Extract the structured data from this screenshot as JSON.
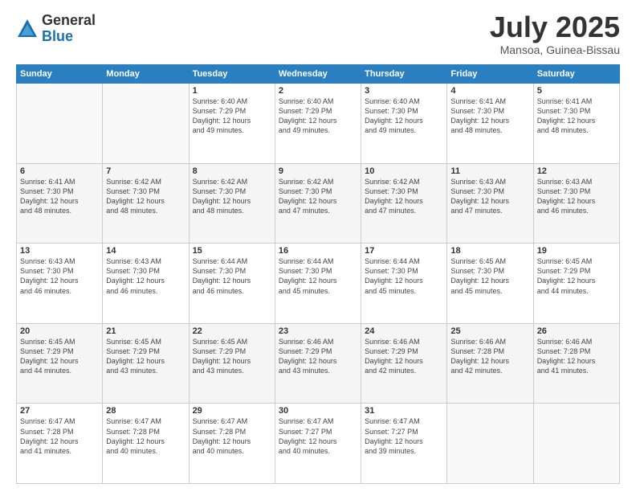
{
  "header": {
    "logo_general": "General",
    "logo_blue": "Blue",
    "month": "July 2025",
    "location": "Mansoa, Guinea-Bissau"
  },
  "days_of_week": [
    "Sunday",
    "Monday",
    "Tuesday",
    "Wednesday",
    "Thursday",
    "Friday",
    "Saturday"
  ],
  "weeks": [
    [
      {
        "day": "",
        "info": ""
      },
      {
        "day": "",
        "info": ""
      },
      {
        "day": "1",
        "info": "Sunrise: 6:40 AM\nSunset: 7:29 PM\nDaylight: 12 hours\nand 49 minutes."
      },
      {
        "day": "2",
        "info": "Sunrise: 6:40 AM\nSunset: 7:29 PM\nDaylight: 12 hours\nand 49 minutes."
      },
      {
        "day": "3",
        "info": "Sunrise: 6:40 AM\nSunset: 7:30 PM\nDaylight: 12 hours\nand 49 minutes."
      },
      {
        "day": "4",
        "info": "Sunrise: 6:41 AM\nSunset: 7:30 PM\nDaylight: 12 hours\nand 48 minutes."
      },
      {
        "day": "5",
        "info": "Sunrise: 6:41 AM\nSunset: 7:30 PM\nDaylight: 12 hours\nand 48 minutes."
      }
    ],
    [
      {
        "day": "6",
        "info": "Sunrise: 6:41 AM\nSunset: 7:30 PM\nDaylight: 12 hours\nand 48 minutes."
      },
      {
        "day": "7",
        "info": "Sunrise: 6:42 AM\nSunset: 7:30 PM\nDaylight: 12 hours\nand 48 minutes."
      },
      {
        "day": "8",
        "info": "Sunrise: 6:42 AM\nSunset: 7:30 PM\nDaylight: 12 hours\nand 48 minutes."
      },
      {
        "day": "9",
        "info": "Sunrise: 6:42 AM\nSunset: 7:30 PM\nDaylight: 12 hours\nand 47 minutes."
      },
      {
        "day": "10",
        "info": "Sunrise: 6:42 AM\nSunset: 7:30 PM\nDaylight: 12 hours\nand 47 minutes."
      },
      {
        "day": "11",
        "info": "Sunrise: 6:43 AM\nSunset: 7:30 PM\nDaylight: 12 hours\nand 47 minutes."
      },
      {
        "day": "12",
        "info": "Sunrise: 6:43 AM\nSunset: 7:30 PM\nDaylight: 12 hours\nand 46 minutes."
      }
    ],
    [
      {
        "day": "13",
        "info": "Sunrise: 6:43 AM\nSunset: 7:30 PM\nDaylight: 12 hours\nand 46 minutes."
      },
      {
        "day": "14",
        "info": "Sunrise: 6:43 AM\nSunset: 7:30 PM\nDaylight: 12 hours\nand 46 minutes."
      },
      {
        "day": "15",
        "info": "Sunrise: 6:44 AM\nSunset: 7:30 PM\nDaylight: 12 hours\nand 46 minutes."
      },
      {
        "day": "16",
        "info": "Sunrise: 6:44 AM\nSunset: 7:30 PM\nDaylight: 12 hours\nand 45 minutes."
      },
      {
        "day": "17",
        "info": "Sunrise: 6:44 AM\nSunset: 7:30 PM\nDaylight: 12 hours\nand 45 minutes."
      },
      {
        "day": "18",
        "info": "Sunrise: 6:45 AM\nSunset: 7:30 PM\nDaylight: 12 hours\nand 45 minutes."
      },
      {
        "day": "19",
        "info": "Sunrise: 6:45 AM\nSunset: 7:29 PM\nDaylight: 12 hours\nand 44 minutes."
      }
    ],
    [
      {
        "day": "20",
        "info": "Sunrise: 6:45 AM\nSunset: 7:29 PM\nDaylight: 12 hours\nand 44 minutes."
      },
      {
        "day": "21",
        "info": "Sunrise: 6:45 AM\nSunset: 7:29 PM\nDaylight: 12 hours\nand 43 minutes."
      },
      {
        "day": "22",
        "info": "Sunrise: 6:45 AM\nSunset: 7:29 PM\nDaylight: 12 hours\nand 43 minutes."
      },
      {
        "day": "23",
        "info": "Sunrise: 6:46 AM\nSunset: 7:29 PM\nDaylight: 12 hours\nand 43 minutes."
      },
      {
        "day": "24",
        "info": "Sunrise: 6:46 AM\nSunset: 7:29 PM\nDaylight: 12 hours\nand 42 minutes."
      },
      {
        "day": "25",
        "info": "Sunrise: 6:46 AM\nSunset: 7:28 PM\nDaylight: 12 hours\nand 42 minutes."
      },
      {
        "day": "26",
        "info": "Sunrise: 6:46 AM\nSunset: 7:28 PM\nDaylight: 12 hours\nand 41 minutes."
      }
    ],
    [
      {
        "day": "27",
        "info": "Sunrise: 6:47 AM\nSunset: 7:28 PM\nDaylight: 12 hours\nand 41 minutes."
      },
      {
        "day": "28",
        "info": "Sunrise: 6:47 AM\nSunset: 7:28 PM\nDaylight: 12 hours\nand 40 minutes."
      },
      {
        "day": "29",
        "info": "Sunrise: 6:47 AM\nSunset: 7:28 PM\nDaylight: 12 hours\nand 40 minutes."
      },
      {
        "day": "30",
        "info": "Sunrise: 6:47 AM\nSunset: 7:27 PM\nDaylight: 12 hours\nand 40 minutes."
      },
      {
        "day": "31",
        "info": "Sunrise: 6:47 AM\nSunset: 7:27 PM\nDaylight: 12 hours\nand 39 minutes."
      },
      {
        "day": "",
        "info": ""
      },
      {
        "day": "",
        "info": ""
      }
    ]
  ]
}
